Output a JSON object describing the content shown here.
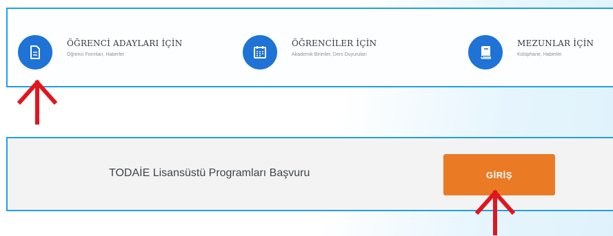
{
  "nav": {
    "items": [
      {
        "title": "ÖĞRENCİ ADAYLARI İÇİN",
        "subtitle": "Öğrenci Formları, Haberler",
        "icon": "document-icon"
      },
      {
        "title": "ÖĞRENCİLER İÇİN",
        "subtitle": "Akademik Birimler, Ders Duyuruları",
        "icon": "calendar-icon"
      },
      {
        "title": "MEZUNLAR İÇİN",
        "subtitle": "Kütüphane, Haberler",
        "icon": "book-icon"
      }
    ]
  },
  "apply": {
    "text": "TODAİE Lisansüstü Programları Başvuru",
    "button_label": "GİRİŞ"
  },
  "colors": {
    "icon_circle": "#1f73d6",
    "border": "#1fa0e0",
    "button": "#ea7a24",
    "arrow": "#e0161e"
  }
}
